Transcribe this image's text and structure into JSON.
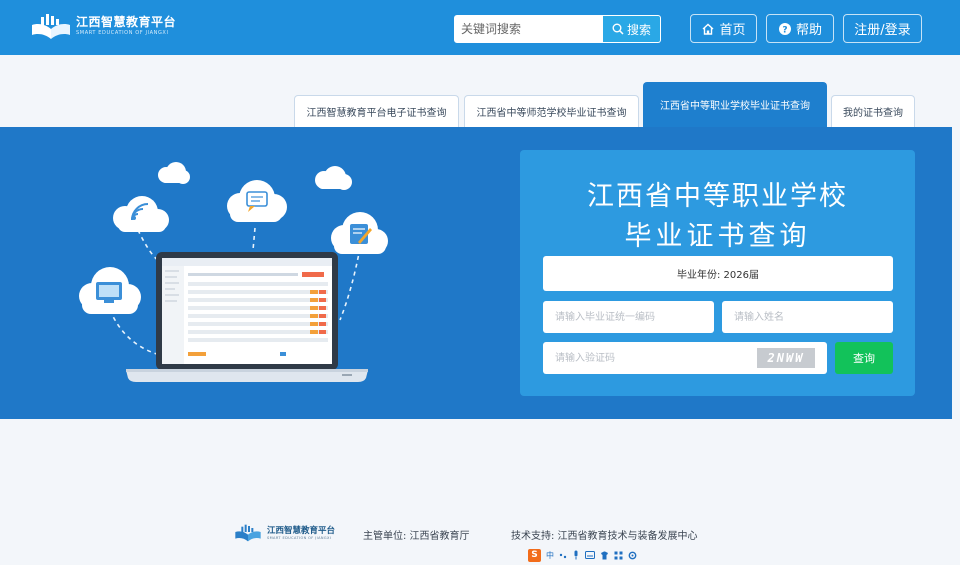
{
  "header": {
    "logo_title": "江西智慧教育平台",
    "logo_subtitle": "SMART EDUCATION OF JIANGXI",
    "search_placeholder": "关键词搜索",
    "search_button": "搜索",
    "nav_home": "首页",
    "nav_help": "帮助",
    "nav_login": "注册/登录"
  },
  "tabs": [
    {
      "label": "江西智慧教育平台电子证书查询",
      "active": false
    },
    {
      "label": "江西省中等师范学校毕业证书查询",
      "active": false
    },
    {
      "label": "江西省中等职业学校毕业证书查询",
      "active": true
    },
    {
      "label": "我的证书查询",
      "active": false
    }
  ],
  "panel": {
    "title_line1": "江西省中等职业学校",
    "title_line2": "毕业证书查询",
    "year_select": "毕业年份: 2026届",
    "cert_placeholder": "请输入毕业证统一编码",
    "name_placeholder": "请输入姓名",
    "code_placeholder": "请输入验证码",
    "captcha_text": "2NWW",
    "query_button": "查询"
  },
  "footer": {
    "logo_title": "江西智慧教育平台",
    "logo_subtitle": "SMART EDUCATION OF JIANGXI",
    "sponsor": "主管单位: 江西省教育厅",
    "support": "技术支持: 江西省教育技术与装备发展中心",
    "ime_label": "中"
  },
  "colors": {
    "header_bg": "#1f8fdc",
    "banner_bg": "#1f78c8",
    "panel_bg": "#2d9ae0",
    "query_button": "#12c25a"
  }
}
